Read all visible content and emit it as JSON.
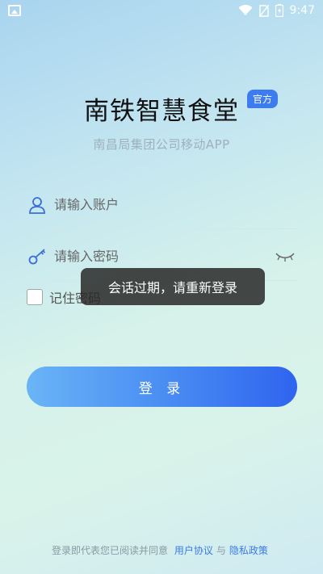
{
  "status_bar": {
    "time": "9:47",
    "icons": [
      "gallery-icon",
      "wifi-icon",
      "no-sim-icon",
      "battery-charging-icon"
    ]
  },
  "header": {
    "title": "南铁智慧食堂",
    "badge": "官方",
    "subtitle": "南昌局集团公司移动APP"
  },
  "form": {
    "account_placeholder": "请输入账户",
    "password_placeholder": "请输入密码",
    "remember_label": "记住密码",
    "login_label": "登 录"
  },
  "toast": {
    "message": "会话过期，请重新登录"
  },
  "agreement": {
    "prefix": "登录即代表您已阅读并同意",
    "user_agreement": "用户协议",
    "and": "与",
    "privacy_policy": "隐私政策"
  },
  "colors": {
    "accent": "#3d7cf0",
    "button_start": "#6ab4f6",
    "button_end": "#2f64ef"
  }
}
